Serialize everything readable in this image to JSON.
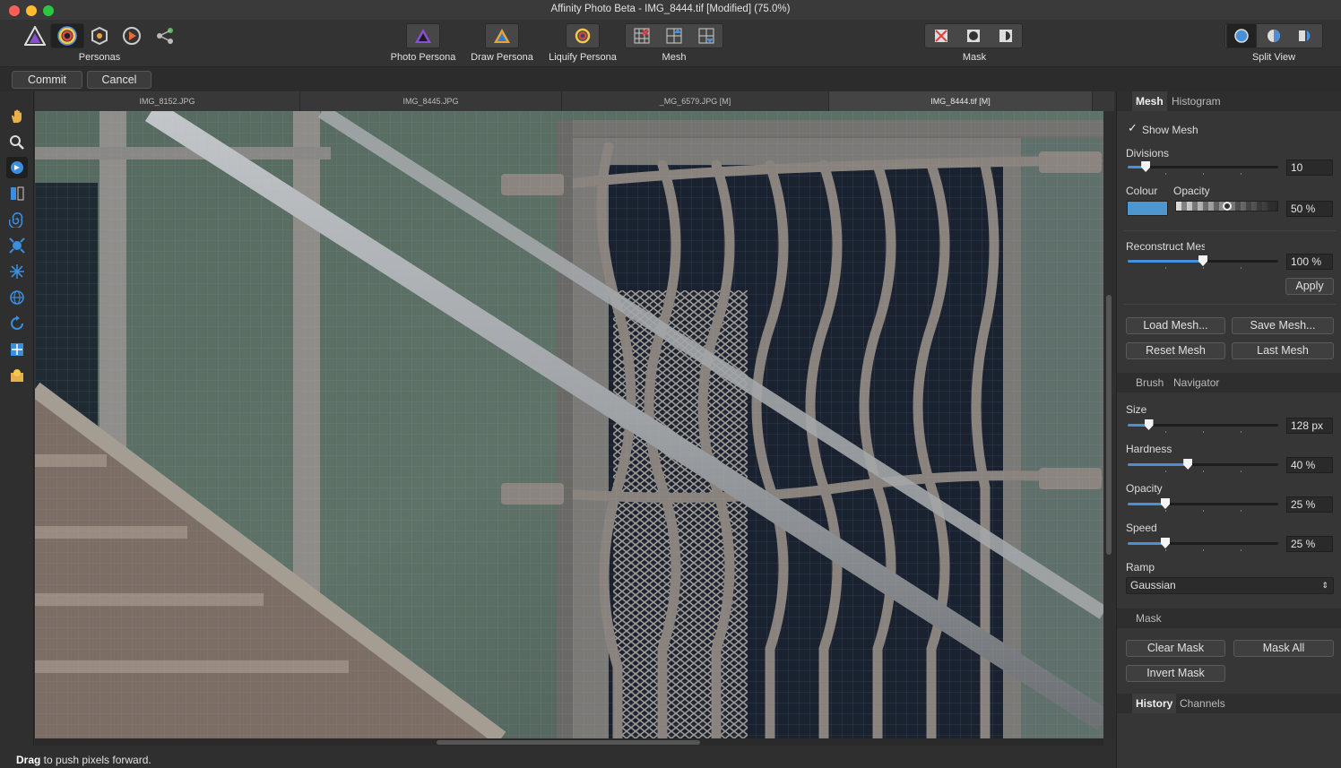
{
  "window": {
    "title": "Affinity Photo Beta - IMG_8444.tif [Modified] (75.0%)"
  },
  "toolbar": {
    "personas_label": "Personas",
    "photo_persona_label": "Photo Persona",
    "draw_persona_label": "Draw Persona",
    "liquify_persona_label": "Liquify Persona",
    "mesh_label": "Mesh",
    "mask_label": "Mask",
    "split_view_label": "Split View"
  },
  "context": {
    "commit_label": "Commit",
    "cancel_label": "Cancel"
  },
  "tabs": [
    {
      "label": "IMG_8152.JPG"
    },
    {
      "label": "IMG_8445.JPG"
    },
    {
      "label": "_MG_6579.JPG [M]"
    },
    {
      "label": "IMG_8444.tif [M]"
    }
  ],
  "mesh_panel": {
    "tab_mesh": "Mesh",
    "tab_histogram": "Histogram",
    "show_mesh_label": "Show Mesh",
    "show_mesh_checked": true,
    "divisions_label": "Divisions",
    "divisions_value": "10",
    "colour_label": "Colour",
    "colour_value": "#4f96cf",
    "opacity_label": "Opacity",
    "opacity_value": "50 %",
    "reconstruct_label": "Reconstruct Mesh",
    "reconstruct_value": "100 %",
    "apply_label": "Apply",
    "load_mesh_label": "Load Mesh...",
    "save_mesh_label": "Save Mesh...",
    "reset_mesh_label": "Reset Mesh",
    "last_mesh_label": "Last Mesh"
  },
  "brush_panel": {
    "tab_brush": "Brush",
    "tab_navigator": "Navigator",
    "size_label": "Size",
    "size_value": "128 px",
    "hardness_label": "Hardness",
    "hardness_value": "40 %",
    "opacity_label": "Opacity",
    "opacity_value": "25 %",
    "speed_label": "Speed",
    "speed_value": "25 %",
    "ramp_label": "Ramp",
    "ramp_value": "Gaussian"
  },
  "mask_panel": {
    "title": "Mask",
    "clear_mask_label": "Clear Mask",
    "mask_all_label": "Mask All",
    "invert_mask_label": "Invert Mask"
  },
  "history_panel": {
    "tab_history": "History",
    "tab_channels": "Channels"
  },
  "status": {
    "bold": "Drag",
    "text": " to push pixels forward."
  },
  "sliders": {
    "divisions": 0.12,
    "reconstruct": 0.5,
    "size": 0.14,
    "hardness": 0.4,
    "opacity": 0.25,
    "speed": 0.25
  }
}
